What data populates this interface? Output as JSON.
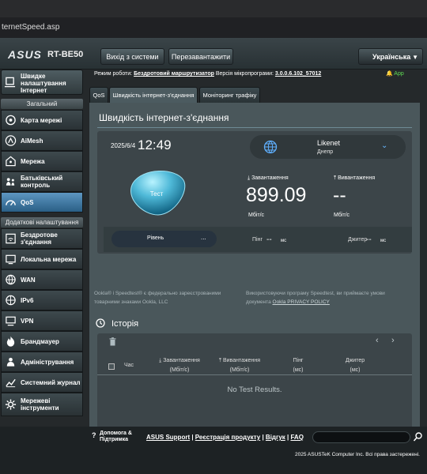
{
  "browser": {
    "url": "ternetSpeed.asp"
  },
  "header": {
    "logo": "ASUS",
    "model": "RT-BE50",
    "logout_label": "Вихід з системи",
    "reboot_label": "Перезавантажити",
    "language": "Українська"
  },
  "status": {
    "mode_prefix": "Режим роботи:",
    "mode_value": "Бездротовий маршрутизатор",
    "fw_prefix": "Версія мікропрограми:",
    "fw_value": "3.0.0.6.102_57012",
    "app_label": "App"
  },
  "sidebar": {
    "quick_setup": "Швидке налаштування Інтернет",
    "general_header": "Загальний",
    "general_items": [
      {
        "label": "Карта мережі",
        "icon": "network-map-icon"
      },
      {
        "label": "AiMesh",
        "icon": "aimesh-icon"
      },
      {
        "label": "Мережа",
        "icon": "network-icon"
      },
      {
        "label": "Батьківський контроль",
        "icon": "parental-control-icon"
      },
      {
        "label": "QoS",
        "icon": "qos-icon",
        "active": true
      }
    ],
    "advanced_header": "Додаткові налаштування",
    "advanced_items": [
      {
        "label": "Бездротове з'єднання",
        "icon": "wireless-icon"
      },
      {
        "label": "Локальна мережа",
        "icon": "lan-icon"
      },
      {
        "label": "WAN",
        "icon": "wan-icon"
      },
      {
        "label": "IPv6",
        "icon": "ipv6-icon"
      },
      {
        "label": "VPN",
        "icon": "vpn-icon"
      },
      {
        "label": "Брандмауер",
        "icon": "firewall-icon"
      },
      {
        "label": "Адміністрування",
        "icon": "admin-icon"
      },
      {
        "label": "Системний журнал",
        "icon": "syslog-icon"
      },
      {
        "label": "Мережеві інструменти",
        "icon": "network-tools-icon"
      }
    ]
  },
  "tabs": [
    {
      "label": "QoS"
    },
    {
      "label": "Швидкість інтернет-з'єднання",
      "active": true
    },
    {
      "label": "Моніторинг трафіку"
    }
  ],
  "speedtest": {
    "title": "Швидкість інтернет-з'єднання",
    "date": "2025/6/4",
    "time": "12:49",
    "isp_name": "Likenet",
    "isp_city": "Днепр",
    "test_button": "Тест",
    "download_label": "Завантаження",
    "upload_label": "Вивантаження",
    "download_value": "899.09",
    "upload_value": "--",
    "download_unit": "Мбіт/с",
    "upload_unit": "Мбіт/с",
    "level_label": "Рівень",
    "level_more": "...",
    "ping_label": "Пінг",
    "ping_value": "--",
    "ping_unit": "мс",
    "jitter_label": "Джитер",
    "jitter_value": "--",
    "jitter_unit": "мс",
    "note_left_1": "Ookla® і Speedtest® є федерально зареєстрованими",
    "note_left_2": "товарними знаками Ookla, LLC",
    "note_right_1": "Використовуючи програму Speedtest, ви приймаєте умови",
    "note_right_2": "документа",
    "privacy_link": "Ookla PRIVACY POLICY",
    "accent": "#1e88e5"
  },
  "history": {
    "title": "Історія",
    "columns": [
      {
        "label": "Час",
        "sub": ""
      },
      {
        "label": "Завантаження",
        "sub": "(Мбіт/с)"
      },
      {
        "label": "Вивантаження",
        "sub": "(Мбіт/с)"
      },
      {
        "label": "Пінг",
        "sub": "(мс)"
      },
      {
        "label": "Джитер",
        "sub": "(мс)"
      }
    ],
    "empty_text": "No Test Results."
  },
  "footer": {
    "help_label_1": "Допомога &",
    "help_label_2": "Підтримка",
    "link_support": "ASUS Support",
    "link_register": "Реєстрація продукту",
    "link_faq_short": "Відгук",
    "link_faq": "FAQ",
    "copyright": "2025 ASUSTeK Computer Inc. Всі права застережені."
  }
}
